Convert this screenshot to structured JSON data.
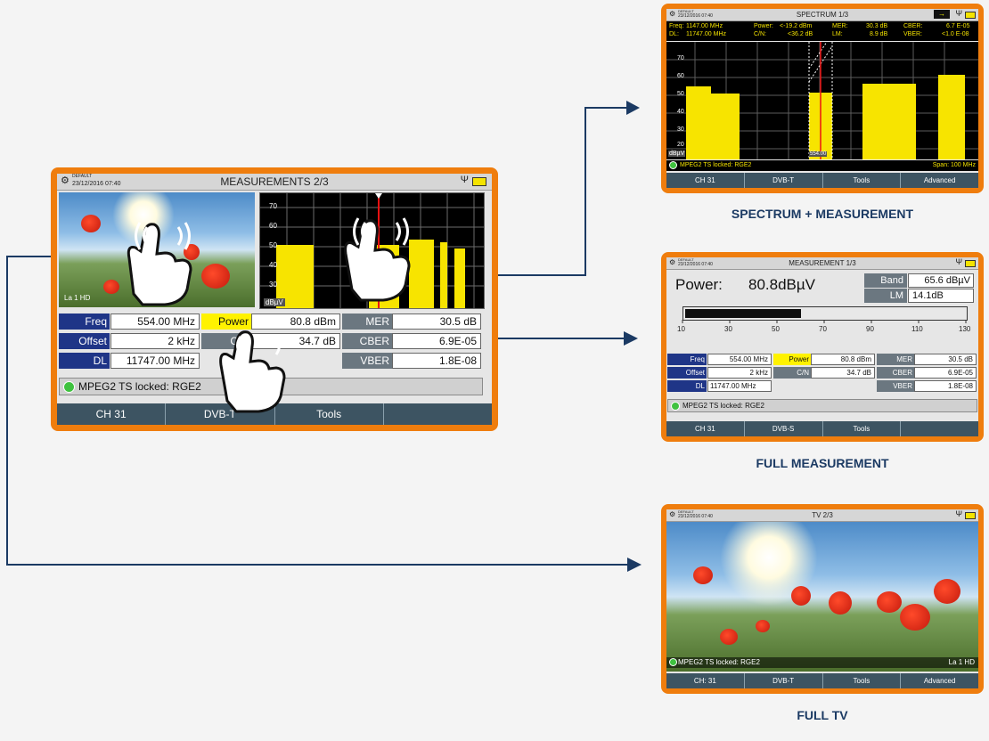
{
  "main": {
    "config": "DEFAULT",
    "datetime": "23/12/2016 07:40",
    "title": "MEASUREMENTS 2/3",
    "tv_channel_label": "La 1 HD",
    "spectrum_ticks": [
      "70",
      "60",
      "50",
      "40",
      "30"
    ],
    "spectrum_unit": "dBµV",
    "rows": [
      {
        "l1": "Freq",
        "v1": "554.00 MHz",
        "l2": "Power",
        "v2": "80.8 dBm",
        "l3": "MER",
        "v3": "30.5 dB"
      },
      {
        "l1": "Offset",
        "v1": "2 kHz",
        "l2": "C/N",
        "v2": "34.7 dB",
        "l3": "CBER",
        "v3": "6.9E-05"
      },
      {
        "l1": "DL",
        "v1": "11747.00 MHz",
        "l2": "",
        "v2": "",
        "l3": "VBER",
        "v3": "1.8E-08"
      }
    ],
    "status": "MPEG2 TS locked: RGE2",
    "softkeys": [
      "CH 31",
      "DVB-T",
      "Tools",
      ""
    ]
  },
  "spectrum_screen": {
    "config": "DEFAULT",
    "datetime": "23/12/2016 07:40",
    "title": "SPECTRUM 1/3",
    "info": {
      "freq_label": "Freq:",
      "freq": "1147.00 MHz",
      "dl_label": "DL:",
      "dl": "11747.00 MHz",
      "power_label": "Power:",
      "power": "<-19.2 dBm",
      "cn_label": "C/N:",
      "cn": "<36.2 dB",
      "mer_label": "MER:",
      "mer": "30.3 dB",
      "lm_label": "LM:",
      "lm": "8.9 dB",
      "cber_label": "CBER:",
      "cber": "6.7 E-05",
      "vber_label": "VBER:",
      "vber": "<1.0 E-08"
    },
    "ticks": [
      "70",
      "60",
      "50",
      "40",
      "30",
      "20"
    ],
    "unit": "dBµV",
    "marker": "554.00",
    "status": "MPEG2 TS locked: RGE2",
    "span": "Span: 100 MHz",
    "softkeys": [
      "CH 31",
      "DVB-T",
      "Tools",
      "Advanced"
    ],
    "caption": "SPECTRUM + MEASUREMENT"
  },
  "meas_screen": {
    "config": "DEFAULT",
    "datetime": "23/12/2016 07:40",
    "title": "MEASUREMENT 1/3",
    "power_label": "Power:",
    "power_value": "80.8dBµV",
    "band_label": "Band",
    "band_value": "65.6 dBµV",
    "lm_label": "LM",
    "lm_value": "14.1dB",
    "bar_level": 0.41,
    "scale": [
      "10",
      "30",
      "50",
      "70",
      "90",
      "110",
      "130"
    ],
    "rows": [
      {
        "l1": "Freq",
        "v1": "554.00 MHz",
        "l2": "Power",
        "v2": "80.8 dBm",
        "l3": "MER",
        "v3": "30.5 dB"
      },
      {
        "l1": "Offset",
        "v1": "2 kHz",
        "l2": "C/N",
        "v2": "34.7 dB",
        "l3": "CBER",
        "v3": "6.9E-05"
      },
      {
        "l1": "DL",
        "v1": "11747.00 MHz",
        "l2": "",
        "v2": "",
        "l3": "VBER",
        "v3": "1.8E-08"
      }
    ],
    "status": "MPEG2 TS locked: RGE2",
    "softkeys": [
      "CH 31",
      "DVB-S",
      "Tools",
      ""
    ],
    "caption": "FULL MEASUREMENT"
  },
  "tv_screen": {
    "config": "DEFAULT",
    "datetime": "23/12/2016 07:40",
    "title": "TV 2/3",
    "status": "MPEG2 TS locked: RGE2",
    "channel": "La 1 HD",
    "softkeys": [
      "CH: 31",
      "DVB-T",
      "Tools",
      "Advanced"
    ],
    "caption": "FULL TV"
  },
  "colors": {
    "frame": "#ef7d0d",
    "arrow": "#1b3a63",
    "label_blue": "#1f3587",
    "label_yellow": "#fff200",
    "spectrum": "#f7e400"
  }
}
